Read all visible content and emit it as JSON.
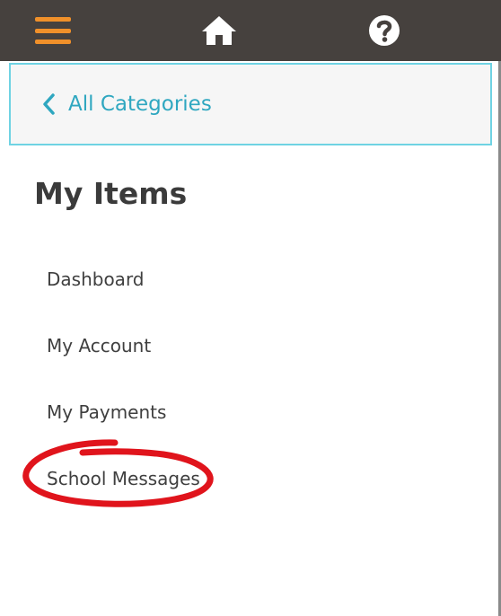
{
  "topbar": {
    "menu_icon": "hamburger-menu-icon",
    "home_icon": "home-icon",
    "help_icon": "help-question-icon",
    "accent_color": "#f0902a",
    "bar_color": "#46413e"
  },
  "category_bar": {
    "back_label": "All Categories",
    "back_icon": "chevron-left-icon",
    "accent_color": "#2fa7c0",
    "border_color": "#6fd3e3"
  },
  "section": {
    "title": "My Items"
  },
  "nav": {
    "items": [
      {
        "label": "Dashboard"
      },
      {
        "label": "My Account"
      },
      {
        "label": "My Payments"
      },
      {
        "label": "School Messages"
      }
    ]
  },
  "annotation": {
    "color": "#e0141c"
  }
}
